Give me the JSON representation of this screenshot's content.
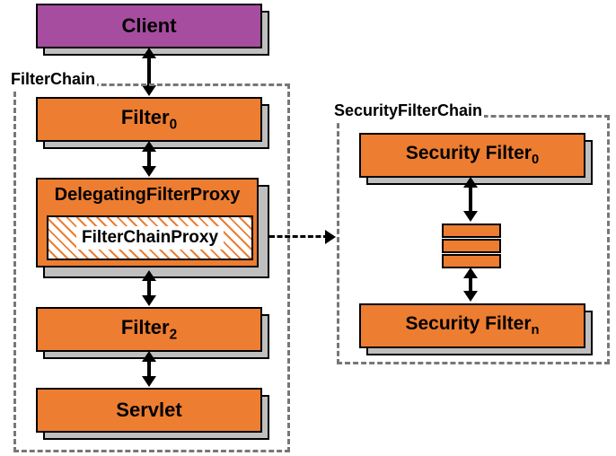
{
  "client": "Client",
  "filterChainLabel": "FilterChain",
  "filter0_prefix": "Filter",
  "filter0_sub": "0",
  "delegating": "DelegatingFilterProxy",
  "filterChainProxy": "FilterChainProxy",
  "filter2_prefix": "Filter",
  "filter2_sub": "2",
  "servlet": "Servlet",
  "securityFilterChainLabel": "SecurityFilterChain",
  "secFilter0_prefix": "Security Filter",
  "secFilter0_sub": "0",
  "secFilterN_prefix": "Security Filter",
  "secFilterN_sub": "n"
}
